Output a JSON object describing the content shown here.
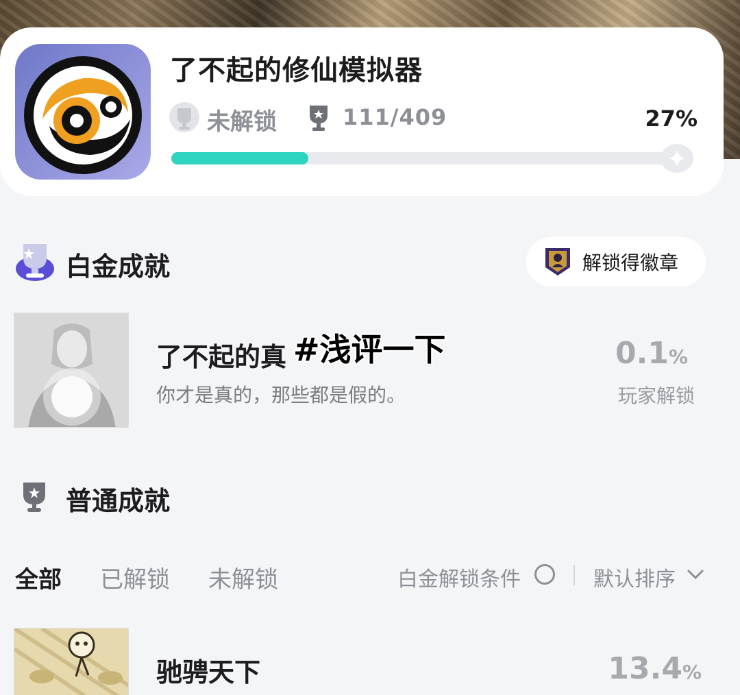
{
  "header": {
    "app_title": "了不起的修仙模拟器",
    "lock_status": "未解锁",
    "trophy_count": "111/409",
    "percent": "27%",
    "progress_fraction": 0.27,
    "accent": "#2fd4c1"
  },
  "platinum": {
    "title": "白金成就",
    "badge_button": "解锁得徽章",
    "achievement": {
      "name": "了不起的真",
      "description": "你才是真的，那些都是假的。",
      "rate_value": "0.1",
      "rate_unit": "%",
      "rate_label": "玩家解锁"
    }
  },
  "overlay_tag": "#浅评一下",
  "normal": {
    "title": "普通成就",
    "tabs": [
      "全部",
      "已解锁",
      "未解锁"
    ],
    "condition_label": "白金解锁条件",
    "sort_label": "默认排序",
    "achievement": {
      "name": "驰骋天下",
      "rate_value": "13.4",
      "rate_unit": "%"
    }
  },
  "icons": {
    "lock": "trophy-silver-icon",
    "trophy": "trophy-icon",
    "progress_end": "star-icon",
    "platinum": "platinum-trophy-icon",
    "badge": "badge-icon",
    "normal": "trophy-icon",
    "condition": "circle-icon",
    "sort": "chevron-down-icon"
  }
}
